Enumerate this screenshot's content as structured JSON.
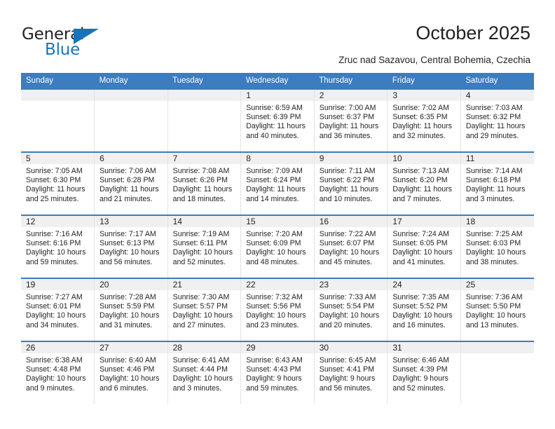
{
  "brand": {
    "logo_text_top": "General",
    "logo_text_bottom": "Blue",
    "logo_icon": "triangle-icon",
    "accent_color": "#1574bb"
  },
  "header": {
    "title": "October 2025",
    "subtitle": "Zruc nad Sazavou, Central Bohemia, Czechia"
  },
  "calendar": {
    "header_bg": "#3c7cbf",
    "daynum_bg": "#f0f0f0",
    "weekdays": [
      "Sunday",
      "Monday",
      "Tuesday",
      "Wednesday",
      "Thursday",
      "Friday",
      "Saturday"
    ],
    "weeks": [
      [
        {
          "day": "",
          "empty": true,
          "sunrise": "",
          "sunset": "",
          "daylight_1": "",
          "daylight_2": ""
        },
        {
          "day": "",
          "empty": true,
          "sunrise": "",
          "sunset": "",
          "daylight_1": "",
          "daylight_2": ""
        },
        {
          "day": "",
          "empty": true,
          "sunrise": "",
          "sunset": "",
          "daylight_1": "",
          "daylight_2": ""
        },
        {
          "day": "1",
          "empty": false,
          "sunrise": "Sunrise: 6:59 AM",
          "sunset": "Sunset: 6:39 PM",
          "daylight_1": "Daylight: 11 hours",
          "daylight_2": "and 40 minutes."
        },
        {
          "day": "2",
          "empty": false,
          "sunrise": "Sunrise: 7:00 AM",
          "sunset": "Sunset: 6:37 PM",
          "daylight_1": "Daylight: 11 hours",
          "daylight_2": "and 36 minutes."
        },
        {
          "day": "3",
          "empty": false,
          "sunrise": "Sunrise: 7:02 AM",
          "sunset": "Sunset: 6:35 PM",
          "daylight_1": "Daylight: 11 hours",
          "daylight_2": "and 32 minutes."
        },
        {
          "day": "4",
          "empty": false,
          "sunrise": "Sunrise: 7:03 AM",
          "sunset": "Sunset: 6:32 PM",
          "daylight_1": "Daylight: 11 hours",
          "daylight_2": "and 29 minutes."
        }
      ],
      [
        {
          "day": "5",
          "empty": false,
          "sunrise": "Sunrise: 7:05 AM",
          "sunset": "Sunset: 6:30 PM",
          "daylight_1": "Daylight: 11 hours",
          "daylight_2": "and 25 minutes."
        },
        {
          "day": "6",
          "empty": false,
          "sunrise": "Sunrise: 7:06 AM",
          "sunset": "Sunset: 6:28 PM",
          "daylight_1": "Daylight: 11 hours",
          "daylight_2": "and 21 minutes."
        },
        {
          "day": "7",
          "empty": false,
          "sunrise": "Sunrise: 7:08 AM",
          "sunset": "Sunset: 6:26 PM",
          "daylight_1": "Daylight: 11 hours",
          "daylight_2": "and 18 minutes."
        },
        {
          "day": "8",
          "empty": false,
          "sunrise": "Sunrise: 7:09 AM",
          "sunset": "Sunset: 6:24 PM",
          "daylight_1": "Daylight: 11 hours",
          "daylight_2": "and 14 minutes."
        },
        {
          "day": "9",
          "empty": false,
          "sunrise": "Sunrise: 7:11 AM",
          "sunset": "Sunset: 6:22 PM",
          "daylight_1": "Daylight: 11 hours",
          "daylight_2": "and 10 minutes."
        },
        {
          "day": "10",
          "empty": false,
          "sunrise": "Sunrise: 7:13 AM",
          "sunset": "Sunset: 6:20 PM",
          "daylight_1": "Daylight: 11 hours",
          "daylight_2": "and 7 minutes."
        },
        {
          "day": "11",
          "empty": false,
          "sunrise": "Sunrise: 7:14 AM",
          "sunset": "Sunset: 6:18 PM",
          "daylight_1": "Daylight: 11 hours",
          "daylight_2": "and 3 minutes."
        }
      ],
      [
        {
          "day": "12",
          "empty": false,
          "sunrise": "Sunrise: 7:16 AM",
          "sunset": "Sunset: 6:16 PM",
          "daylight_1": "Daylight: 10 hours",
          "daylight_2": "and 59 minutes."
        },
        {
          "day": "13",
          "empty": false,
          "sunrise": "Sunrise: 7:17 AM",
          "sunset": "Sunset: 6:13 PM",
          "daylight_1": "Daylight: 10 hours",
          "daylight_2": "and 56 minutes."
        },
        {
          "day": "14",
          "empty": false,
          "sunrise": "Sunrise: 7:19 AM",
          "sunset": "Sunset: 6:11 PM",
          "daylight_1": "Daylight: 10 hours",
          "daylight_2": "and 52 minutes."
        },
        {
          "day": "15",
          "empty": false,
          "sunrise": "Sunrise: 7:20 AM",
          "sunset": "Sunset: 6:09 PM",
          "daylight_1": "Daylight: 10 hours",
          "daylight_2": "and 48 minutes."
        },
        {
          "day": "16",
          "empty": false,
          "sunrise": "Sunrise: 7:22 AM",
          "sunset": "Sunset: 6:07 PM",
          "daylight_1": "Daylight: 10 hours",
          "daylight_2": "and 45 minutes."
        },
        {
          "day": "17",
          "empty": false,
          "sunrise": "Sunrise: 7:24 AM",
          "sunset": "Sunset: 6:05 PM",
          "daylight_1": "Daylight: 10 hours",
          "daylight_2": "and 41 minutes."
        },
        {
          "day": "18",
          "empty": false,
          "sunrise": "Sunrise: 7:25 AM",
          "sunset": "Sunset: 6:03 PM",
          "daylight_1": "Daylight: 10 hours",
          "daylight_2": "and 38 minutes."
        }
      ],
      [
        {
          "day": "19",
          "empty": false,
          "sunrise": "Sunrise: 7:27 AM",
          "sunset": "Sunset: 6:01 PM",
          "daylight_1": "Daylight: 10 hours",
          "daylight_2": "and 34 minutes."
        },
        {
          "day": "20",
          "empty": false,
          "sunrise": "Sunrise: 7:28 AM",
          "sunset": "Sunset: 5:59 PM",
          "daylight_1": "Daylight: 10 hours",
          "daylight_2": "and 31 minutes."
        },
        {
          "day": "21",
          "empty": false,
          "sunrise": "Sunrise: 7:30 AM",
          "sunset": "Sunset: 5:57 PM",
          "daylight_1": "Daylight: 10 hours",
          "daylight_2": "and 27 minutes."
        },
        {
          "day": "22",
          "empty": false,
          "sunrise": "Sunrise: 7:32 AM",
          "sunset": "Sunset: 5:56 PM",
          "daylight_1": "Daylight: 10 hours",
          "daylight_2": "and 23 minutes."
        },
        {
          "day": "23",
          "empty": false,
          "sunrise": "Sunrise: 7:33 AM",
          "sunset": "Sunset: 5:54 PM",
          "daylight_1": "Daylight: 10 hours",
          "daylight_2": "and 20 minutes."
        },
        {
          "day": "24",
          "empty": false,
          "sunrise": "Sunrise: 7:35 AM",
          "sunset": "Sunset: 5:52 PM",
          "daylight_1": "Daylight: 10 hours",
          "daylight_2": "and 16 minutes."
        },
        {
          "day": "25",
          "empty": false,
          "sunrise": "Sunrise: 7:36 AM",
          "sunset": "Sunset: 5:50 PM",
          "daylight_1": "Daylight: 10 hours",
          "daylight_2": "and 13 minutes."
        }
      ],
      [
        {
          "day": "26",
          "empty": false,
          "sunrise": "Sunrise: 6:38 AM",
          "sunset": "Sunset: 4:48 PM",
          "daylight_1": "Daylight: 10 hours",
          "daylight_2": "and 9 minutes."
        },
        {
          "day": "27",
          "empty": false,
          "sunrise": "Sunrise: 6:40 AM",
          "sunset": "Sunset: 4:46 PM",
          "daylight_1": "Daylight: 10 hours",
          "daylight_2": "and 6 minutes."
        },
        {
          "day": "28",
          "empty": false,
          "sunrise": "Sunrise: 6:41 AM",
          "sunset": "Sunset: 4:44 PM",
          "daylight_1": "Daylight: 10 hours",
          "daylight_2": "and 3 minutes."
        },
        {
          "day": "29",
          "empty": false,
          "sunrise": "Sunrise: 6:43 AM",
          "sunset": "Sunset: 4:43 PM",
          "daylight_1": "Daylight: 9 hours",
          "daylight_2": "and 59 minutes."
        },
        {
          "day": "30",
          "empty": false,
          "sunrise": "Sunrise: 6:45 AM",
          "sunset": "Sunset: 4:41 PM",
          "daylight_1": "Daylight: 9 hours",
          "daylight_2": "and 56 minutes."
        },
        {
          "day": "31",
          "empty": false,
          "sunrise": "Sunrise: 6:46 AM",
          "sunset": "Sunset: 4:39 PM",
          "daylight_1": "Daylight: 9 hours",
          "daylight_2": "and 52 minutes."
        },
        {
          "day": "",
          "empty": true,
          "sunrise": "",
          "sunset": "",
          "daylight_1": "",
          "daylight_2": ""
        }
      ]
    ]
  }
}
